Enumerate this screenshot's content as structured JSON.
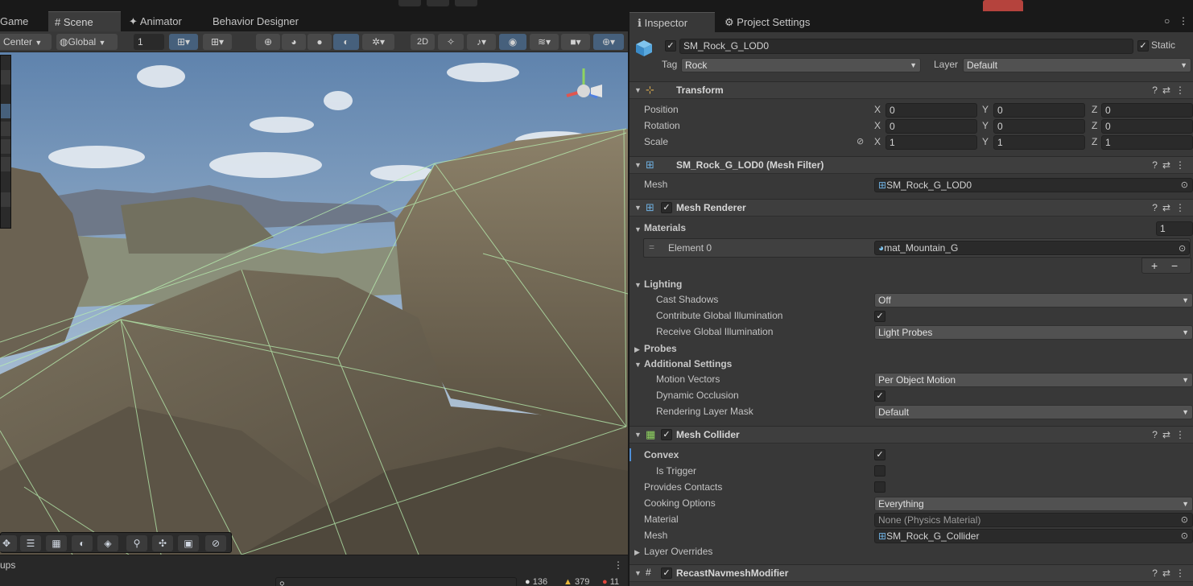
{
  "scene_tabs": [
    "Game",
    "Scene",
    "Animator",
    "Behavior Designer"
  ],
  "toolbar": {
    "pivot": "Center",
    "space": "Global",
    "grid_size": "1",
    "mode_2d": "2D"
  },
  "inspector_tabs": [
    "Inspector",
    "Project Settings"
  ],
  "object": {
    "name": "SM_Rock_G_LOD0",
    "static_label": "Static",
    "tag_label": "Tag",
    "tag_value": "Rock",
    "layer_label": "Layer",
    "layer_value": "Default"
  },
  "transform": {
    "title": "Transform",
    "rows": [
      {
        "label": "Position",
        "x": "0",
        "y": "0",
        "z": "0"
      },
      {
        "label": "Rotation",
        "x": "0",
        "y": "0",
        "z": "0"
      },
      {
        "label": "Scale",
        "x": "1",
        "y": "1",
        "z": "1"
      }
    ],
    "axes": [
      "X",
      "Y",
      "Z"
    ]
  },
  "mesh_filter": {
    "title": "SM_Rock_G_LOD0 (Mesh Filter)",
    "mesh_label": "Mesh",
    "mesh_value": "SM_Rock_G_LOD0"
  },
  "mesh_renderer": {
    "title": "Mesh Renderer",
    "materials_label": "Materials",
    "materials_count": "1",
    "element_label": "Element 0",
    "element_value": "mat_Mountain_G",
    "lighting_label": "Lighting",
    "cast_shadows_label": "Cast Shadows",
    "cast_shadows_value": "Off",
    "contribute_gi_label": "Contribute Global Illumination",
    "receive_gi_label": "Receive Global Illumination",
    "receive_gi_value": "Light Probes",
    "probes_label": "Probes",
    "additional_label": "Additional Settings",
    "motion_vectors_label": "Motion Vectors",
    "motion_vectors_value": "Per Object Motion",
    "dynamic_occlusion_label": "Dynamic Occlusion",
    "rendering_layer_label": "Rendering Layer Mask",
    "rendering_layer_value": "Default",
    "add": "+",
    "remove": "−"
  },
  "mesh_collider": {
    "title": "Mesh Collider",
    "convex_label": "Convex",
    "is_trigger_label": "Is Trigger",
    "provides_contacts_label": "Provides Contacts",
    "cooking_label": "Cooking Options",
    "cooking_value": "Everything",
    "material_label": "Material",
    "material_value": "None (Physics Material)",
    "mesh_label": "Mesh",
    "mesh_value": "SM_Rock_G_Collider",
    "layer_overrides_label": "Layer Overrides"
  },
  "recast": {
    "title": "RecastNavmeshModifier"
  },
  "console": {
    "tab_label": "ups",
    "info_count": "136",
    "warning_count": "379",
    "error_count": "11"
  },
  "colors": {
    "panel": "#383838",
    "header": "#3e3e3e",
    "field": "#2a2a2a",
    "dropdown": "#515151",
    "accent": "#46607c",
    "wire": "#b9f0b0"
  }
}
